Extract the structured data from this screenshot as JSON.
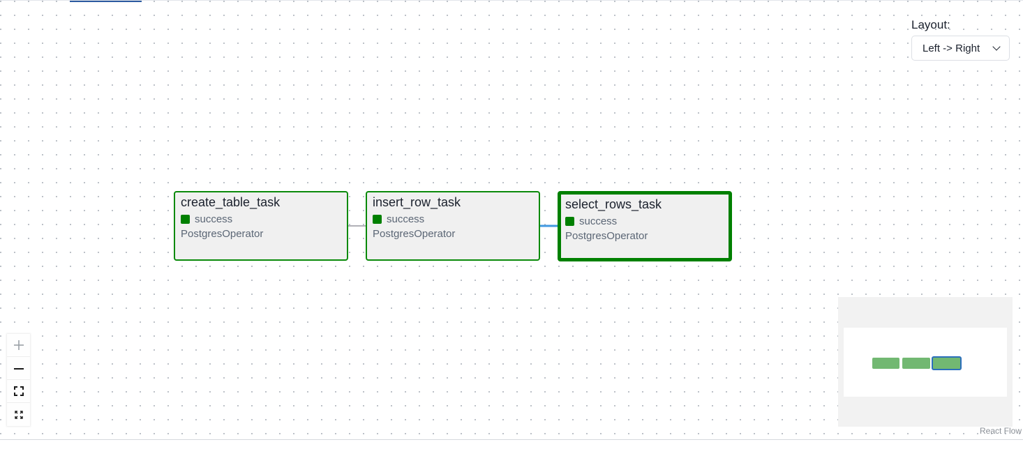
{
  "layout": {
    "label": "Layout:",
    "selected": "Left -> Right"
  },
  "nodes": [
    {
      "title": "create_table_task",
      "status": "success",
      "operator": "PostgresOperator",
      "selected": false
    },
    {
      "title": "insert_row_task",
      "status": "success",
      "operator": "PostgresOperator",
      "selected": false
    },
    {
      "title": "select_rows_task",
      "status": "success",
      "operator": "PostgresOperator",
      "selected": true
    }
  ],
  "colors": {
    "success": "#008000",
    "selected_edge": "#4299e1",
    "edge": "#b1b1b7"
  },
  "controls": {
    "zoom_in": "plus-icon",
    "zoom_out": "minus-icon",
    "fit_view": "fit-view-icon",
    "fullscreen": "expand-icon"
  },
  "attribution": "React Flow"
}
